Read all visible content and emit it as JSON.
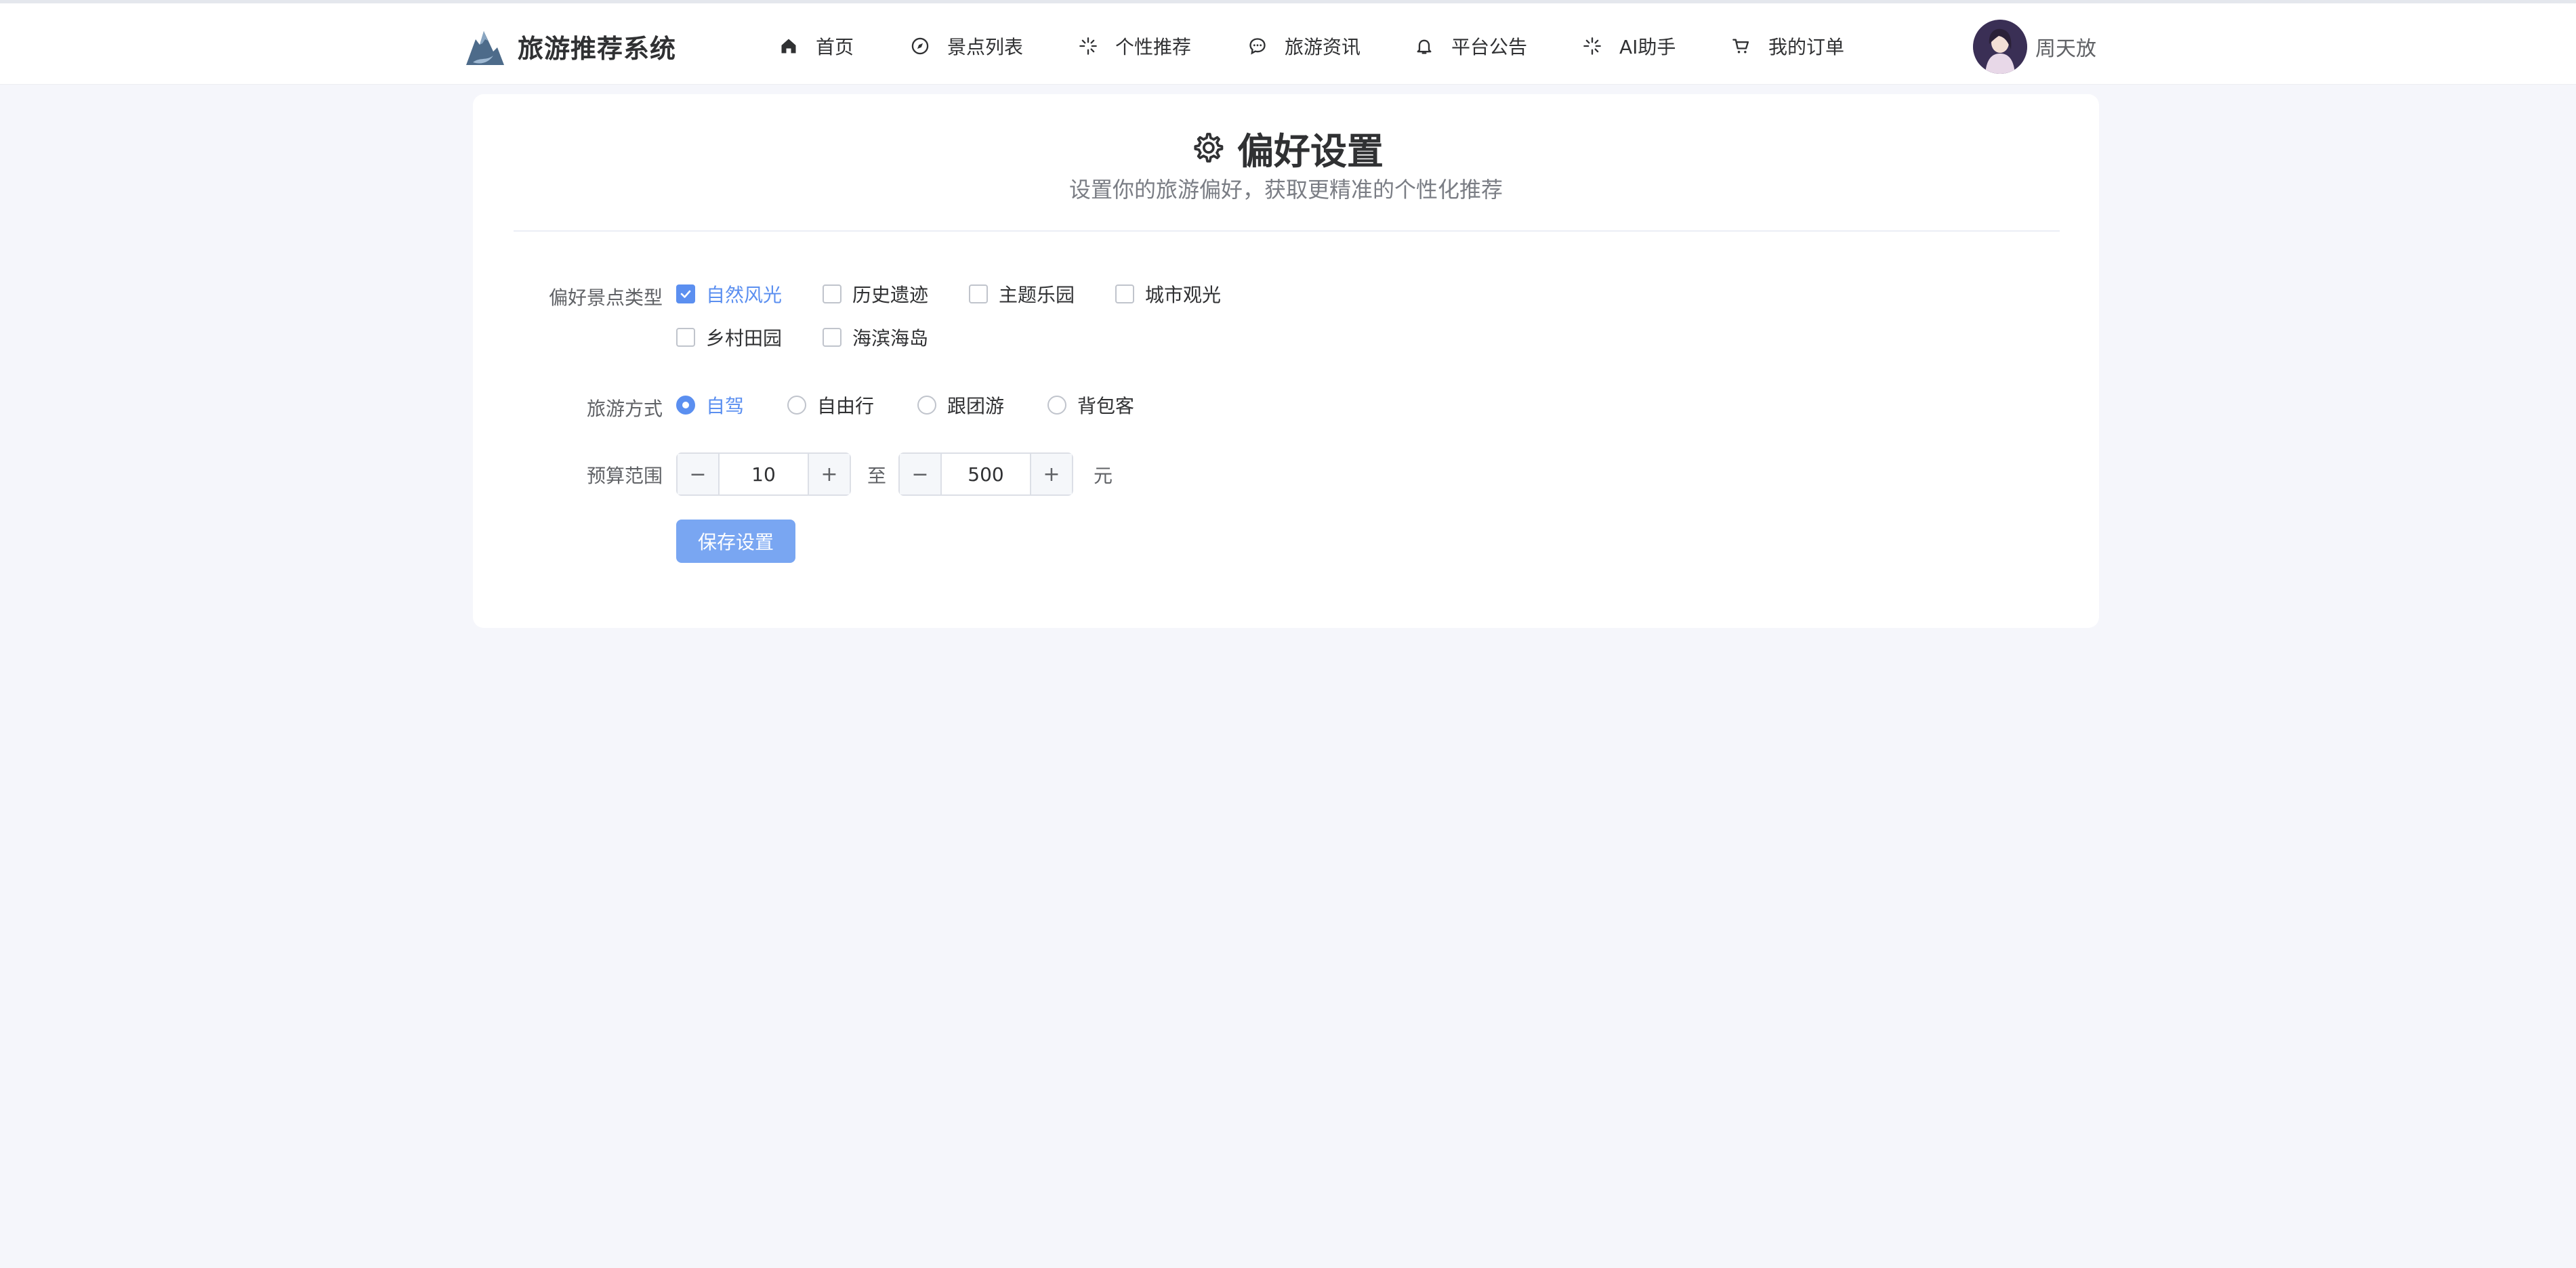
{
  "app": {
    "title": "旅游推荐系统"
  },
  "nav": {
    "items": [
      {
        "label": "首页",
        "icon": "home-icon"
      },
      {
        "label": "景点列表",
        "icon": "compass-icon"
      },
      {
        "label": "个性推荐",
        "icon": "sparkle-icon"
      },
      {
        "label": "旅游资讯",
        "icon": "chat-bubble-icon"
      },
      {
        "label": "平台公告",
        "icon": "bell-icon"
      },
      {
        "label": "AI助手",
        "icon": "sparkle-icon"
      },
      {
        "label": "我的订单",
        "icon": "cart-icon"
      }
    ]
  },
  "user": {
    "name": "周天放"
  },
  "page": {
    "title": "偏好设置",
    "subtitle": "设置你的旅游偏好，获取更精准的个性化推荐"
  },
  "form": {
    "scenic_types": {
      "label": "偏好景点类型",
      "options": [
        {
          "label": "自然风光",
          "checked": true
        },
        {
          "label": "历史遗迹",
          "checked": false
        },
        {
          "label": "主题乐园",
          "checked": false
        },
        {
          "label": "城市观光",
          "checked": false
        },
        {
          "label": "乡村田园",
          "checked": false
        },
        {
          "label": "海滨海岛",
          "checked": false
        }
      ]
    },
    "travel_mode": {
      "label": "旅游方式",
      "options": [
        {
          "label": "自驾",
          "selected": true
        },
        {
          "label": "自由行",
          "selected": false
        },
        {
          "label": "跟团游",
          "selected": false
        },
        {
          "label": "背包客",
          "selected": false
        }
      ]
    },
    "budget": {
      "label": "预算范围",
      "min": "10",
      "separator": "至",
      "max": "500",
      "unit": "元",
      "minus": "−",
      "plus": "+"
    },
    "save_label": "保存设置"
  },
  "colors": {
    "accent": "#5b8ff0",
    "save_button": "#79a6f2",
    "background": "#f5f6fb"
  }
}
